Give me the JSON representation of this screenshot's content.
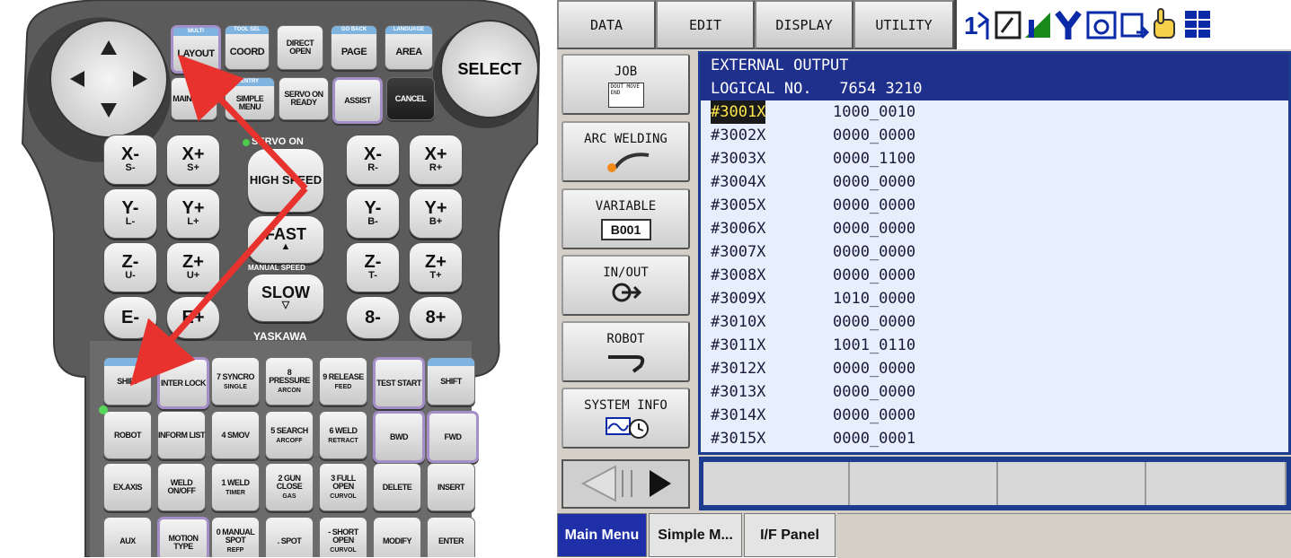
{
  "pendant": {
    "select_label": "SELECT",
    "top_keys": [
      {
        "top": "MULTI",
        "main": "LAYOUT"
      },
      {
        "top": "TOOL SEL",
        "main": "COORD"
      },
      {
        "top": "",
        "main": "DIRECT OPEN"
      },
      {
        "top": "GO BACK",
        "main": "PAGE"
      },
      {
        "top": "LANGUAGE",
        "main": "AREA"
      }
    ],
    "row2_keys": [
      {
        "top": "",
        "main": "MAIN MENU"
      },
      {
        "top": "ENTRY",
        "main": "SIMPLE MENU"
      },
      {
        "top": "",
        "main": "SERVO ON READY"
      },
      {
        "top": "",
        "main": "ASSIST"
      },
      {
        "top": "",
        "main": "CANCEL"
      }
    ],
    "servo_on_label": "SERVO ON",
    "axis_left": [
      {
        "big": "X-",
        "sub": "S-"
      },
      {
        "big": "X+",
        "sub": "S+"
      },
      {
        "big": "Y-",
        "sub": "L-"
      },
      {
        "big": "Y+",
        "sub": "L+"
      },
      {
        "big": "Z-",
        "sub": "U-"
      },
      {
        "big": "Z+",
        "sub": "U+"
      }
    ],
    "axis_right": [
      {
        "big": "X-",
        "sub": "R-"
      },
      {
        "big": "X+",
        "sub": "R+"
      },
      {
        "big": "Y-",
        "sub": "B-"
      },
      {
        "big": "Y+",
        "sub": "B+"
      },
      {
        "big": "Z-",
        "sub": "T-"
      },
      {
        "big": "Z+",
        "sub": "T+"
      }
    ],
    "speed": {
      "high": "HIGH SPEED",
      "fast": "FAST",
      "manual": "MANUAL SPEED",
      "slow": "SLOW"
    },
    "ext_axis": [
      "E-",
      "E+",
      "8-",
      "8+"
    ],
    "brand": "YASKAWA",
    "grid_rows": [
      [
        {
          "main": "SHIFT"
        },
        {
          "main": "INTER LOCK"
        },
        {
          "main": "7 SYNCRO",
          "sub": "SINGLE"
        },
        {
          "main": "8 PRESSURE",
          "sub": "ARCON"
        },
        {
          "main": "9 RELEASE",
          "sub": "FEED"
        },
        {
          "main": "TEST START"
        },
        {
          "main": "SHIFT"
        }
      ],
      [
        {
          "main": "ROBOT"
        },
        {
          "main": "INFORM LIST"
        },
        {
          "main": "4 SMOV"
        },
        {
          "main": "5 SEARCH",
          "sub": "ARCOFF"
        },
        {
          "main": "6 WELD",
          "sub": "RETRACT"
        },
        {
          "main": "BWD"
        },
        {
          "main": "FWD"
        }
      ],
      [
        {
          "main": "EX.AXIS"
        },
        {
          "main": "WELD ON/OFF"
        },
        {
          "main": "1 WELD",
          "sub": "TIMER"
        },
        {
          "main": "2 GUN CLOSE",
          "sub": "GAS"
        },
        {
          "main": "3 FULL OPEN",
          "sub": "CURVOL"
        },
        {
          "main": "DELETE"
        },
        {
          "main": "INSERT"
        }
      ],
      [
        {
          "main": "AUX"
        },
        {
          "main": "MOTION TYPE"
        },
        {
          "main": "0 MANUAL SPOT",
          "sub": "REFP"
        },
        {
          "main": ". SPOT"
        },
        {
          "main": "- SHORT OPEN",
          "sub": "CURVOL"
        },
        {
          "main": "MODIFY"
        },
        {
          "main": "ENTER"
        }
      ]
    ],
    "arrow_color": "#e8322e"
  },
  "screen": {
    "top_menu": [
      "DATA",
      "EDIT",
      "DISPLAY",
      "UTILITY"
    ],
    "status_icons": [
      "1-2-icon",
      "edit-icon",
      "signal-icon",
      "y-icon",
      "camera-icon",
      "export-icon",
      "hand-icon",
      "grid-icon"
    ],
    "side_menu": [
      {
        "label": "JOB",
        "icon": "job-icon",
        "icon_text": "DOUT MOVE END"
      },
      {
        "label": "ARC WELDING",
        "icon": "welding-torch-icon",
        "icon_text": ""
      },
      {
        "label": "VARIABLE",
        "icon": "variable-icon",
        "icon_text": "B001"
      },
      {
        "label": "IN/OUT",
        "icon": "in-out-icon",
        "icon_text": "In Out"
      },
      {
        "label": "ROBOT",
        "icon": "robot-arm-icon",
        "icon_text": ""
      },
      {
        "label": "SYSTEM INFO",
        "icon": "system-info-icon",
        "icon_text": ""
      }
    ],
    "content": {
      "title": "EXTERNAL OUTPUT",
      "logical_label": "LOGICAL NO.",
      "logical_value": "7654 3210",
      "rows": [
        {
          "id": "#3001X",
          "value": "1000_0010"
        },
        {
          "id": "#3002X",
          "value": "0000_0000"
        },
        {
          "id": "#3003X",
          "value": "0000_1100"
        },
        {
          "id": "#3004X",
          "value": "0000_0000"
        },
        {
          "id": "#3005X",
          "value": "0000_0000"
        },
        {
          "id": "#3006X",
          "value": "0000_0000"
        },
        {
          "id": "#3007X",
          "value": "0000_0000"
        },
        {
          "id": "#3008X",
          "value": "0000_0000"
        },
        {
          "id": "#3009X",
          "value": "1010_0000"
        },
        {
          "id": "#3010X",
          "value": "0000_0000"
        },
        {
          "id": "#3011X",
          "value": "1001_0110"
        },
        {
          "id": "#3012X",
          "value": "0000_0000"
        },
        {
          "id": "#3013X",
          "value": "0000_0000"
        },
        {
          "id": "#3014X",
          "value": "0000_0000"
        },
        {
          "id": "#3015X",
          "value": "0000_0001"
        }
      ],
      "selected_index": 0
    },
    "bottom_tabs": [
      "Main Menu",
      "Simple M...",
      "I/F Panel"
    ],
    "active_tab": 0
  }
}
